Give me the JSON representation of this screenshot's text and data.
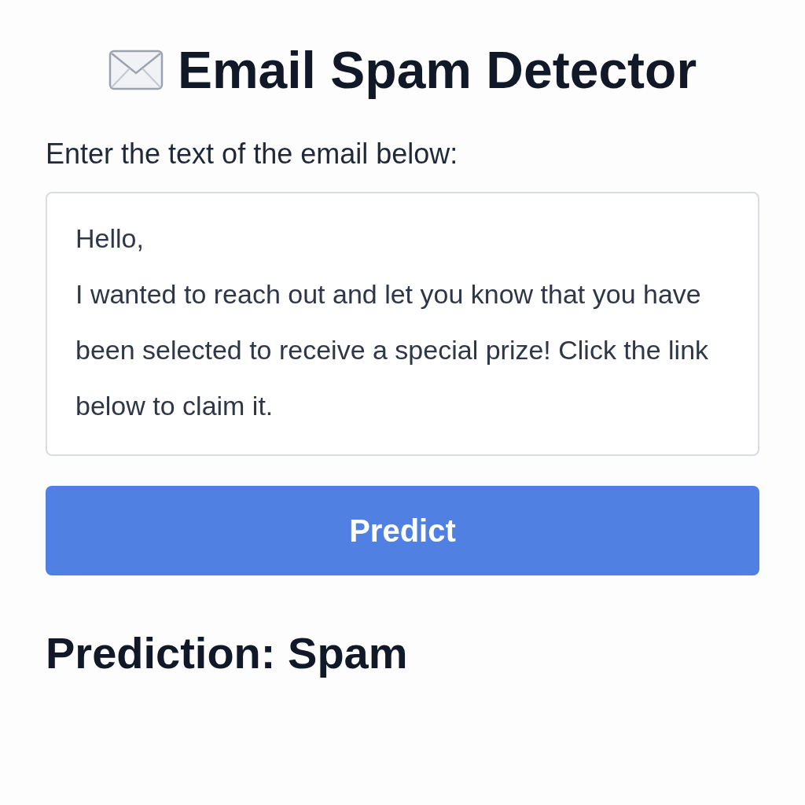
{
  "title": "Email Spam Detector",
  "prompt": "Enter the text of the email below:",
  "email_field": {
    "value": "Hello,\nI wanted to reach out and let you know that you have been selected to receive a special prize! Click the link below to claim it."
  },
  "predict_button": {
    "label": "Predict"
  },
  "result": "Prediction: Spam"
}
